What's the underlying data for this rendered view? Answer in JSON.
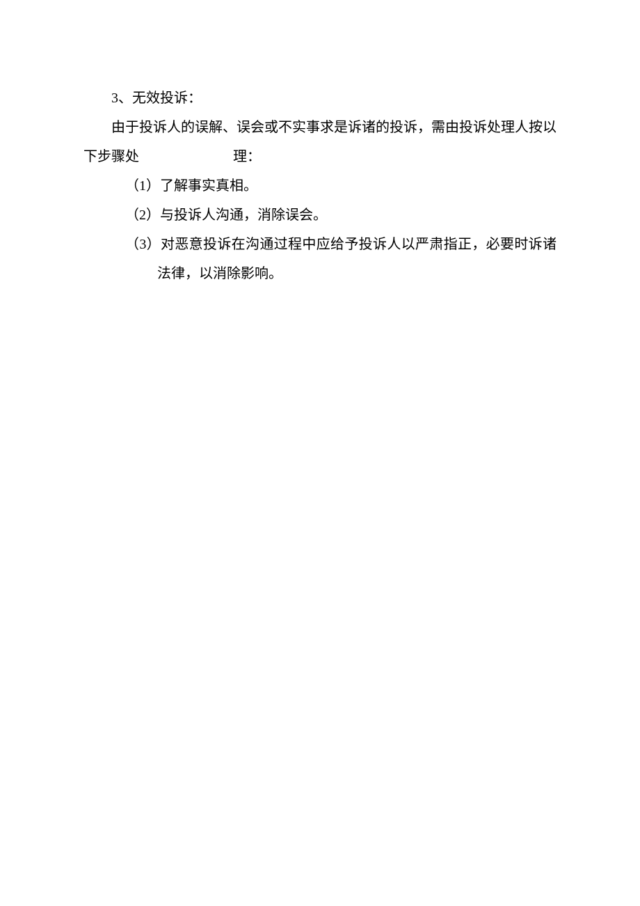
{
  "line1": "3、无效投诉：",
  "line2_part1": "由于投诉人的误解、误会或不实事求是诉诸的投诉，需由投诉处理人按以下步骤处",
  "line2_part2": "理：",
  "item1": "（1）了解事实真相。",
  "item2": "（2）与投诉人沟通，消除误会。",
  "item3": "（3）对恶意投诉在沟通过程中应给予投诉人以严肃指正，必要时诉诸法律，以消除影响。"
}
